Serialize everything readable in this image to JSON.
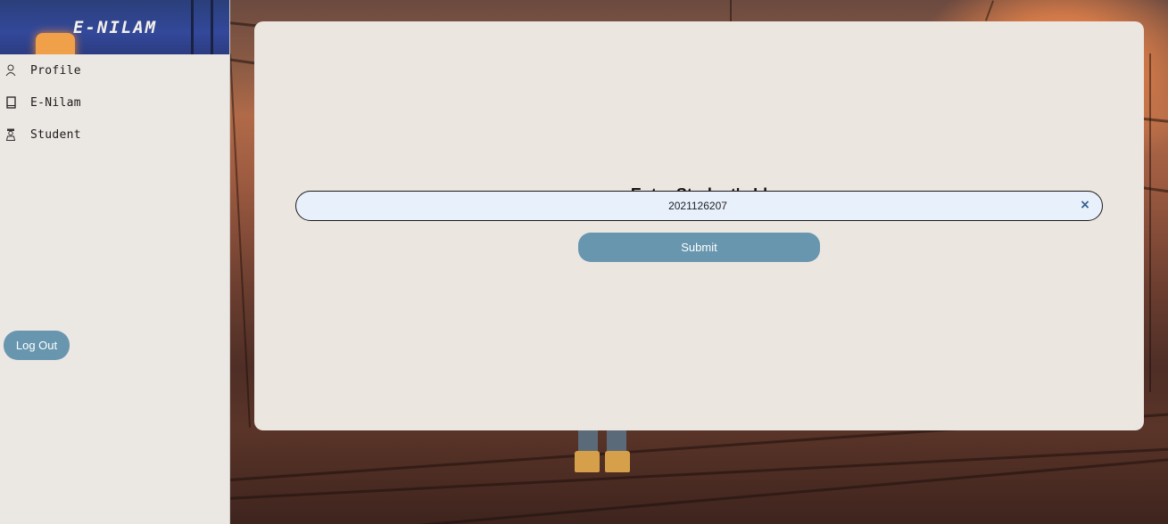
{
  "brand": {
    "title": "E-NILAM"
  },
  "sidebar": {
    "items": [
      {
        "label": "Profile",
        "icon": "person-icon"
      },
      {
        "label": "E-Nilam",
        "icon": "book-icon"
      },
      {
        "label": "Student",
        "icon": "student-icon"
      }
    ],
    "logout_label": "Log Out"
  },
  "main": {
    "title": "Enter Student's Id",
    "student_id_value": "2021126207",
    "clear_glyph": "×",
    "submit_label": "Submit"
  },
  "colors": {
    "accent": "#6796ae",
    "sidebar_bg": "#ebe7e3",
    "card_bg": "#ebe6e0",
    "input_bg": "#e8f0fc"
  }
}
